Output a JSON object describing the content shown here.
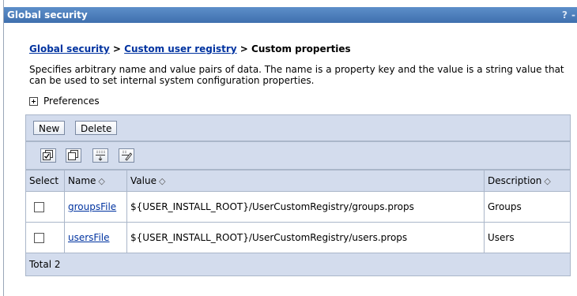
{
  "window": {
    "title": "Global security",
    "help": "?",
    "minimize": "-"
  },
  "breadcrumb": {
    "link1": "Global security",
    "sep1": " > ",
    "link2": "Custom user registry",
    "sep2": " > ",
    "current": "Custom properties"
  },
  "description": "Specifies arbitrary name and value pairs of data. The name is a property key and the value is a string value that can be used to set internal system configuration properties.",
  "preferences": {
    "label": "Preferences"
  },
  "toolbar": {
    "new_label": "New",
    "delete_label": "Delete"
  },
  "icons": [
    "select-all-icon",
    "deselect-all-icon",
    "expand-icon",
    "filter-icon"
  ],
  "table": {
    "headers": {
      "select": "Select",
      "name": "Name",
      "value": "Value",
      "description": "Description",
      "sort_glyph": "◇"
    },
    "rows": [
      {
        "name": "groupsFile",
        "value": "${USER_INSTALL_ROOT}/UserCustomRegistry/groups.props",
        "description": "Groups"
      },
      {
        "name": "usersFile",
        "value": "${USER_INSTALL_ROOT}/UserCustomRegistry/users.props",
        "description": "Users"
      }
    ],
    "total": "Total 2"
  },
  "colors": {
    "titlebar": "#4a7cbc",
    "header_bg": "#d3dced",
    "link": "#0033a0"
  }
}
